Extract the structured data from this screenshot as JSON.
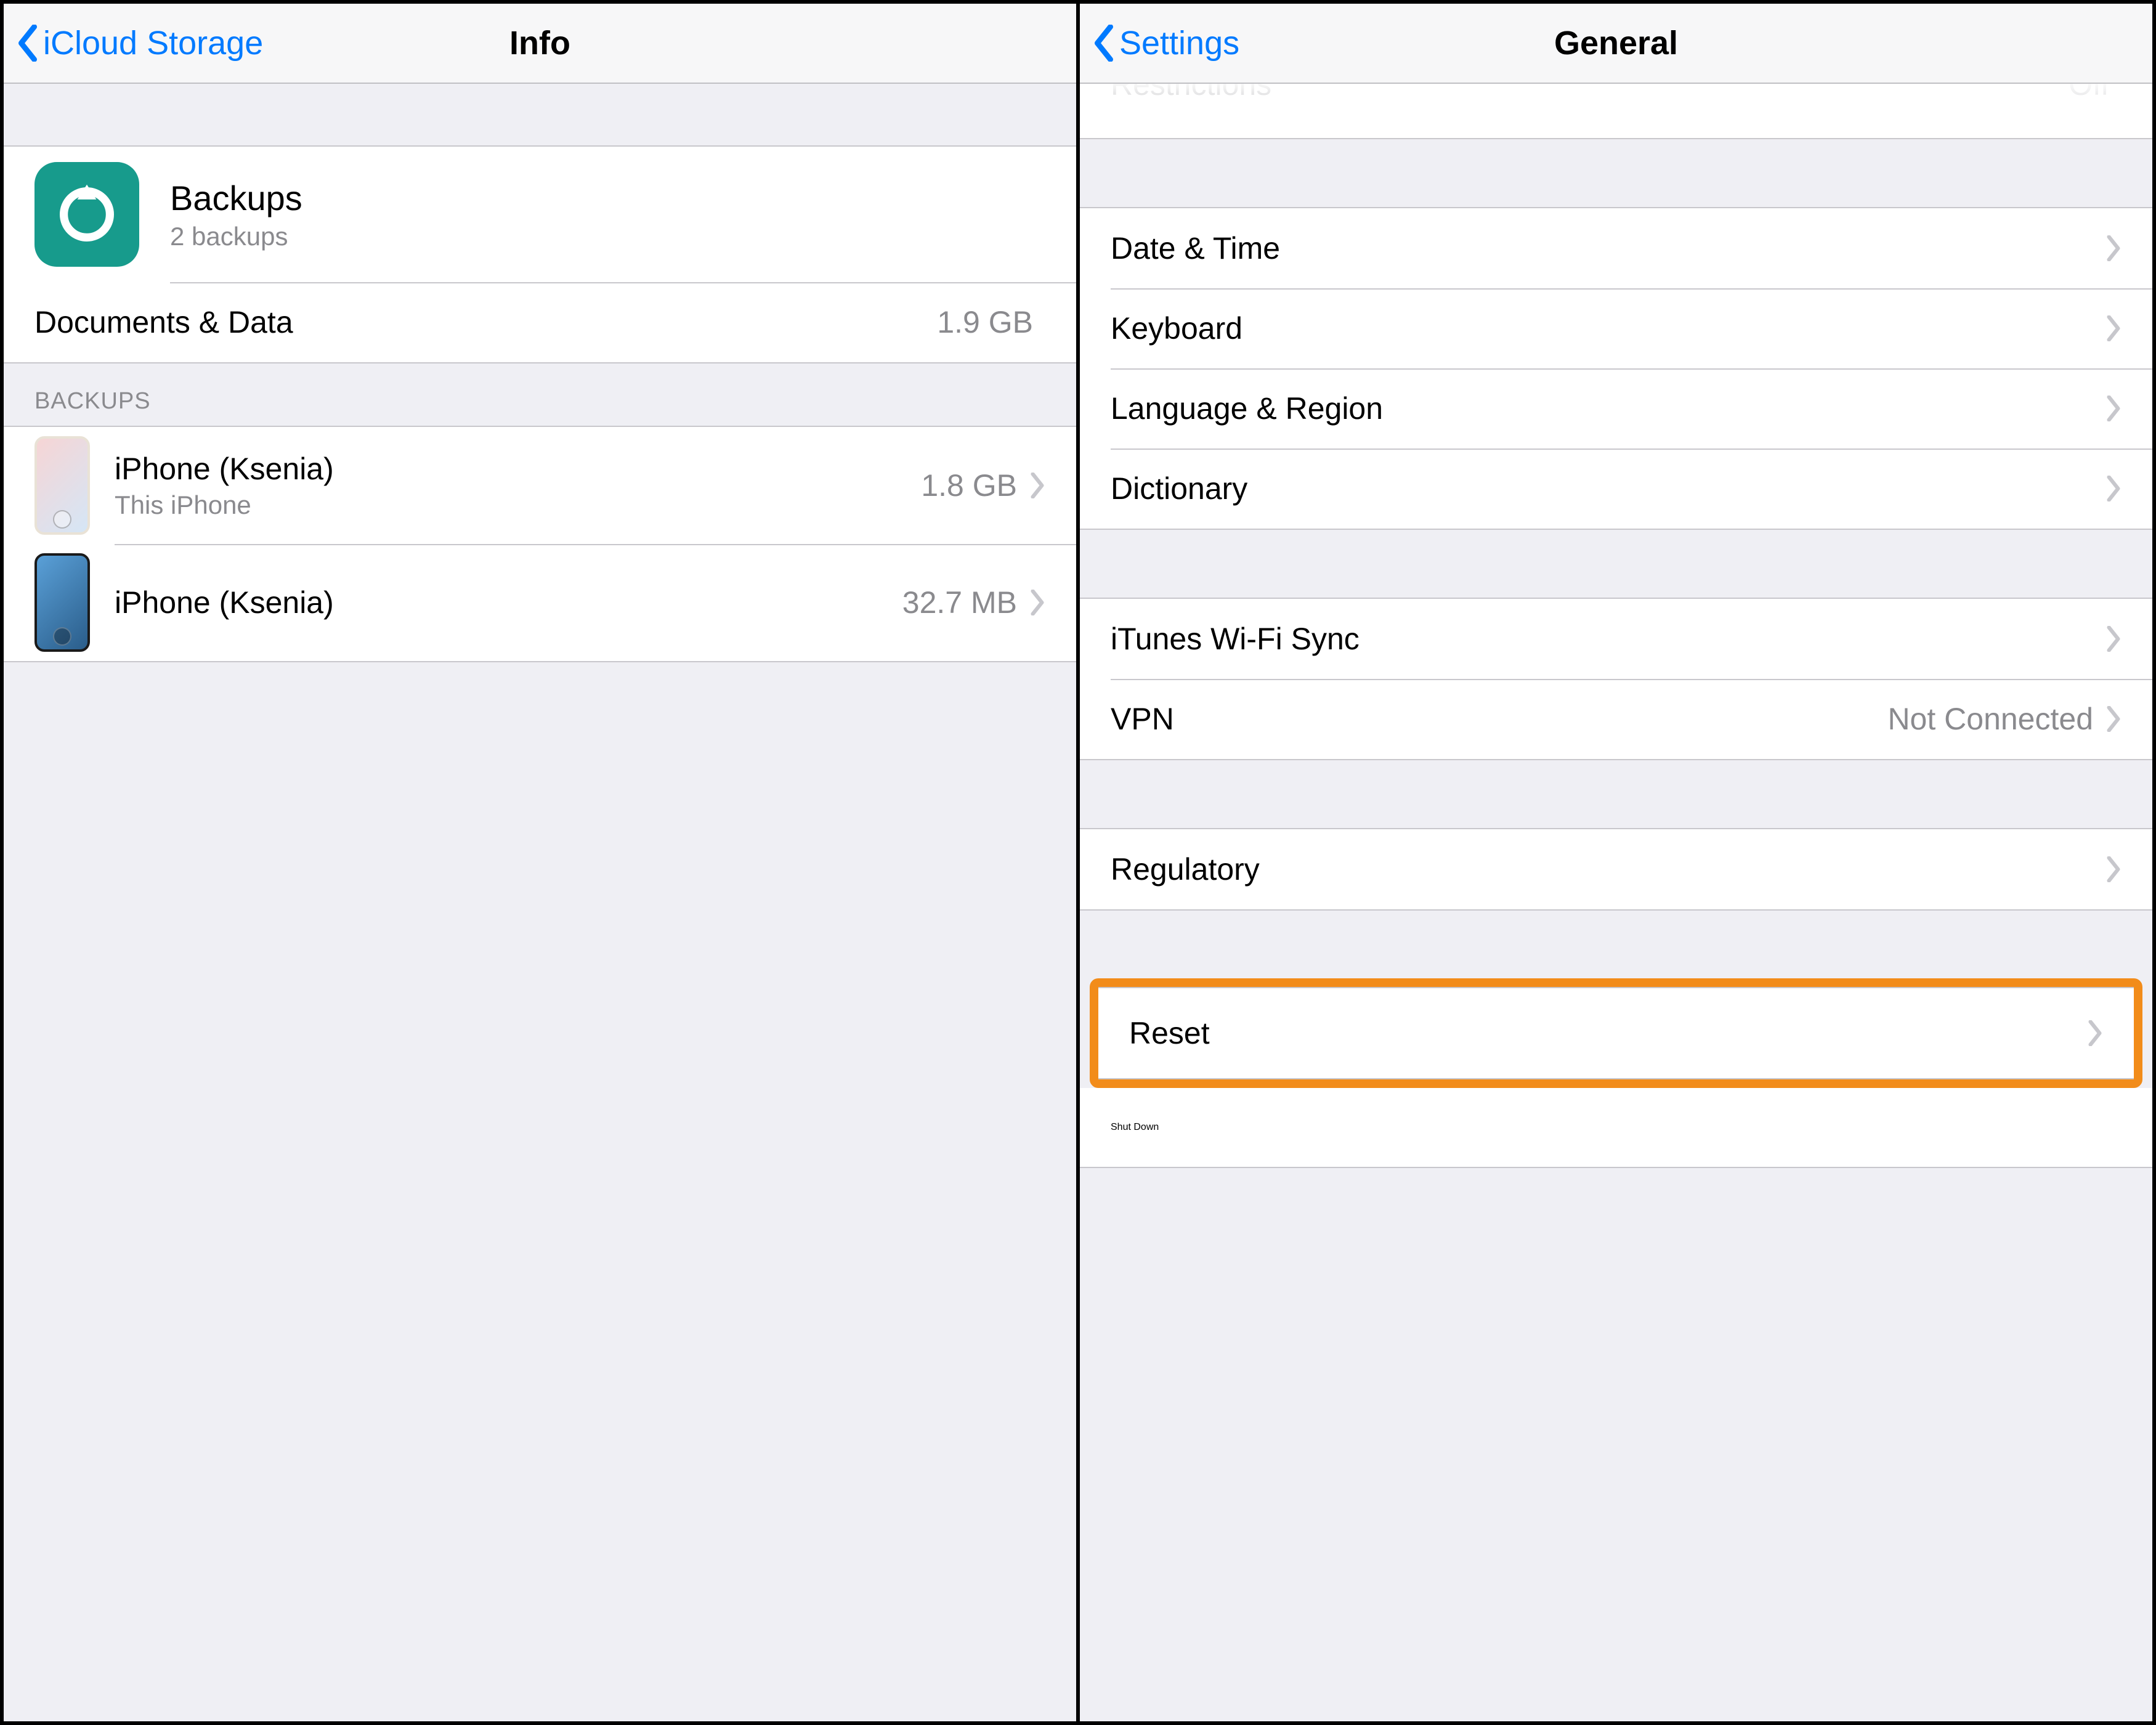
{
  "left": {
    "nav": {
      "back": "iCloud Storage",
      "title": "Info"
    },
    "backups_row": {
      "title": "Backups",
      "subtitle": "2 backups"
    },
    "docs_row": {
      "label": "Documents & Data",
      "value": "1.9 GB"
    },
    "backups_header": "BACKUPS",
    "backup_items": [
      {
        "name": "iPhone (Ksenia)",
        "sub": "This iPhone",
        "size": "1.8 GB"
      },
      {
        "name": "iPhone (Ksenia)",
        "sub": "",
        "size": "32.7 MB"
      }
    ]
  },
  "right": {
    "nav": {
      "back": "Settings",
      "title": "General"
    },
    "cutoff": {
      "label": "Restrictions",
      "value": "Off"
    },
    "group1": [
      {
        "label": "Date & Time"
      },
      {
        "label": "Keyboard"
      },
      {
        "label": "Language & Region"
      },
      {
        "label": "Dictionary"
      }
    ],
    "group2": [
      {
        "label": "iTunes Wi-Fi Sync",
        "value": ""
      },
      {
        "label": "VPN",
        "value": "Not Connected"
      }
    ],
    "group3": [
      {
        "label": "Regulatory"
      }
    ],
    "reset": {
      "label": "Reset"
    },
    "shutdown": {
      "label": "Shut Down"
    }
  },
  "colors": {
    "link": "#007aff",
    "teal": "#179b8c",
    "highlight": "#f28c1a"
  }
}
